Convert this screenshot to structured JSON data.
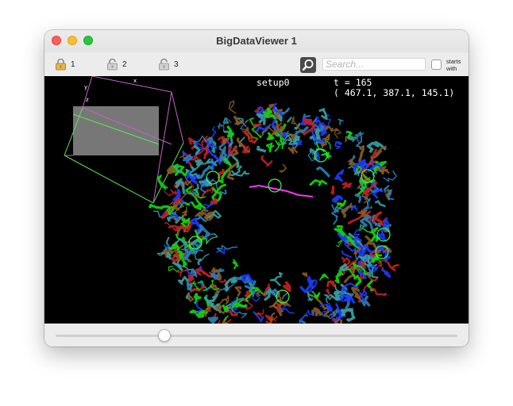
{
  "window": {
    "title": "BigDataViewer 1",
    "close_color": "#ff5f57",
    "minimize_color": "#febc2e",
    "maximize_color": "#28c840"
  },
  "toolbar": {
    "source_buttons": [
      {
        "label": "1",
        "icon": "lock-closed-icon",
        "locked": true
      },
      {
        "label": "2",
        "icon": "lock-open-icon",
        "locked": false
      },
      {
        "label": "3",
        "icon": "lock-open-icon",
        "locked": false
      }
    ],
    "search_icon": "magnifier-icon",
    "search_placeholder": "Search...",
    "search_value": "",
    "checkbox_label": "starts with",
    "checkbox_checked": false
  },
  "viewer": {
    "source_name": "setup0",
    "timepoint_text": "t = 165",
    "coordinates_text": "( 467.1, 387.1, 145.1)",
    "navigator_axis_labels": [
      "x",
      "y",
      "z"
    ],
    "track_colors": [
      "#1a3cff",
      "#14d414",
      "#2a7fb4",
      "#8a5a20",
      "#c42020",
      "#3aa0a0"
    ],
    "highlight_track_color": "#ff33ff"
  },
  "timeline": {
    "value": 165,
    "position_fraction": 0.27
  }
}
